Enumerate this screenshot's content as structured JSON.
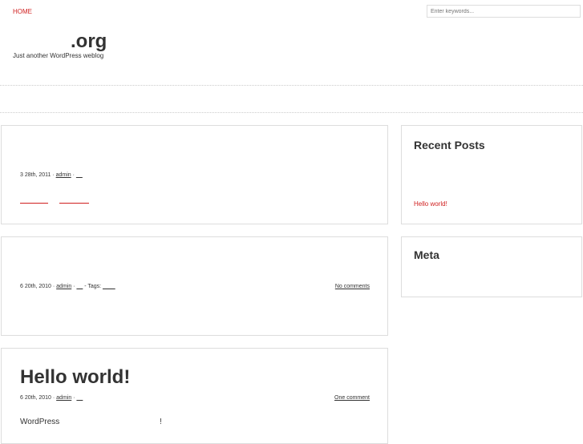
{
  "nav": {
    "home": "HOME"
  },
  "search": {
    "placeholder": "Enter keywords..."
  },
  "site": {
    "title": ".org",
    "tagline": "Just another WordPress weblog"
  },
  "posts": [
    {
      "date": "3  28th, 2011 · ",
      "author": "admin",
      "sep": " · ",
      "category": "__",
      "links": [
        "________",
        "_________"
      ]
    },
    {
      "date": "6  20th, 2010 · ",
      "author": "admin",
      "sep": " · ",
      "category": "__",
      "tags_label": " - Tags: ",
      "tags": "____",
      "comments": "No comments"
    },
    {
      "title": "Hello world!",
      "date": "6  20th, 2010 · ",
      "author": "admin",
      "sep": " · ",
      "category": "__",
      "comments": "One comment",
      "excerpt_start": "WordPress",
      "excerpt_end": "!"
    }
  ],
  "sidebar": {
    "recent_posts": {
      "title": "Recent Posts",
      "items": [
        "Hello world!"
      ]
    },
    "meta": {
      "title": "Meta"
    }
  },
  "colors": {
    "accent": "#d01f1f",
    "text": "#333333",
    "border": "#dddddd"
  }
}
